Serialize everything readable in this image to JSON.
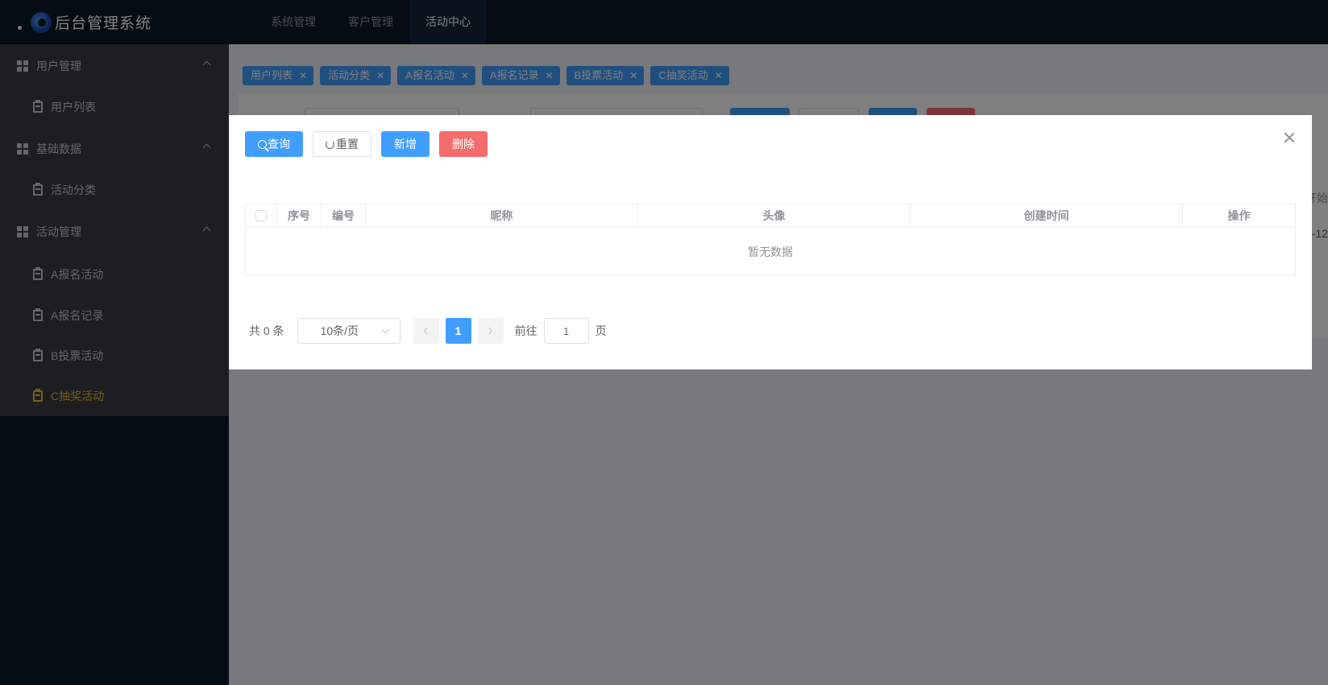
{
  "header": {
    "app_title": "后台管理系统",
    "nav": [
      {
        "label": "系统管理",
        "active": false
      },
      {
        "label": "客户管理",
        "active": false
      },
      {
        "label": "活动中心",
        "active": true
      }
    ]
  },
  "sidebar": {
    "groups": [
      {
        "label": "用户管理",
        "items": [
          {
            "label": "用户列表"
          }
        ]
      },
      {
        "label": "基础数据",
        "items": [
          {
            "label": "活动分类"
          }
        ]
      },
      {
        "label": "活动管理",
        "items": [
          {
            "label": "A报名活动"
          },
          {
            "label": "A报名记录"
          },
          {
            "label": "B投票活动"
          },
          {
            "label": "C抽奖活动",
            "active": true
          }
        ]
      }
    ]
  },
  "tags": [
    "用户列表",
    "活动分类",
    "A报名活动",
    "A报名记录",
    "B投票活动",
    "C抽奖活动"
  ],
  "background": {
    "col_header_partial": "开始",
    "col_value_partial": "-12"
  },
  "dialog": {
    "toolbar": {
      "query_label": "查询",
      "reset_label": "重置",
      "add_label": "新增",
      "delete_label": "删除"
    },
    "table": {
      "columns": [
        "序号",
        "编号",
        "昵称",
        "头像",
        "创建时间",
        "操作"
      ],
      "empty_text": "暂无数据"
    },
    "pagination": {
      "total_text": "共 0 条",
      "page_size": "10条/页",
      "current_page": "1",
      "goto_label": "前往",
      "goto_value": "1",
      "page_suffix": "页"
    }
  },
  "colors": {
    "primary": "#409eff",
    "danger": "#f56c6c",
    "sidebar_active": "#f2b933",
    "header_bg": "#0d1826"
  }
}
